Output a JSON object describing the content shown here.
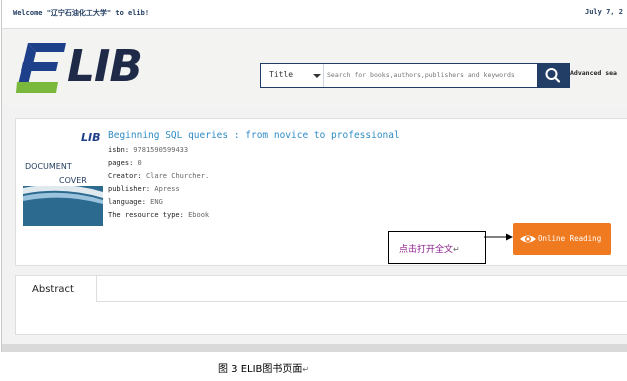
{
  "top_bar": {
    "welcome": "Welcome \"辽宁石油化工大学\" to elib!",
    "date": "July 7, 2"
  },
  "logo": {
    "text": "LIB"
  },
  "search": {
    "type_selected": "Title",
    "placeholder": "Search for books,authors,publishers and keywords",
    "advanced_label": "Advanced sea"
  },
  "book": {
    "title": "Beginning SQL queries : from novice to professional",
    "cover": {
      "brand": "LIB",
      "line1": "DOCUMENT",
      "line2": "COVER"
    },
    "fields": [
      {
        "label": "isbn:",
        "value": "9781590599433"
      },
      {
        "label": "pages:",
        "value": "0"
      },
      {
        "label": "Creator:",
        "value": "Clare Churcher."
      },
      {
        "label": "publisher:",
        "value": "Apress"
      },
      {
        "label": "language:",
        "value": "ENG"
      },
      {
        "label": "The resource type:",
        "value": "Ebook"
      }
    ]
  },
  "callout": {
    "text": "点击打开全文",
    "return_mark": "↵"
  },
  "online_reading": {
    "label": "Online Reading"
  },
  "tabs": [
    {
      "label": "Abstract"
    }
  ],
  "caption": {
    "text": "图 3 ELIB图书页面",
    "return_mark": "↵"
  },
  "colors": {
    "accent": "#f07a1f",
    "navy": "#233e66",
    "link": "#2f8bc4",
    "callout_text": "#8b1d8b"
  }
}
